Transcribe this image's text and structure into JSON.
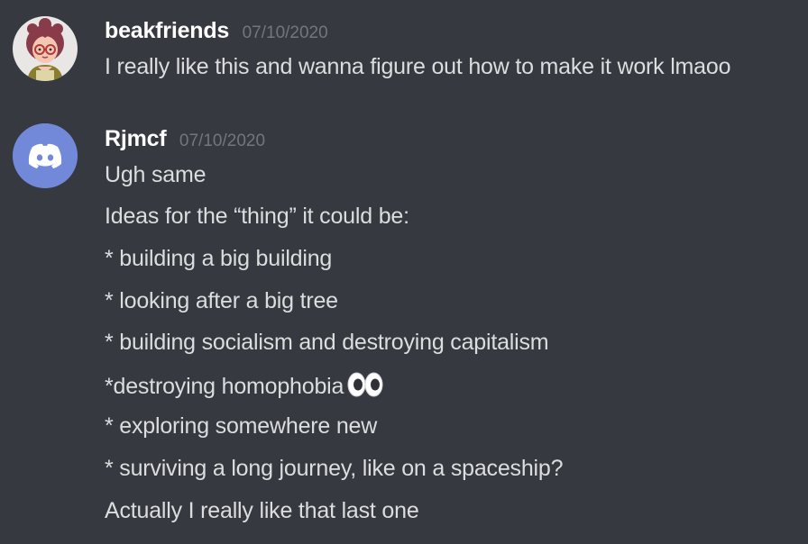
{
  "messages": [
    {
      "username": "beakfriends",
      "timestamp": "07/10/2020",
      "avatar": "cartoon-girl-glasses-avatar",
      "lines": [
        "I really like this and wanna figure out how to make it work lmaoo"
      ]
    },
    {
      "username": "Rjmcf",
      "timestamp": "07/10/2020",
      "avatar": "discord-default-avatar",
      "avatar_color": "#7289da",
      "lines": [
        "Ugh same",
        "Ideas for the “thing” it could be:",
        "* building a big building",
        "* looking after a big tree",
        "* building socialism and destroying capitalism",
        "*destroying homophobia",
        "* exploring somewhere new",
        "* surviving a long journey, like on a spaceship?",
        "Actually I really like that last one"
      ],
      "emoji_after_line_6": "eyes-emoji"
    }
  ],
  "colors": {
    "background": "#36393f",
    "username": "#ffffff",
    "text": "#dcddde",
    "timestamp": "#72767d",
    "blurple": "#7289da"
  }
}
